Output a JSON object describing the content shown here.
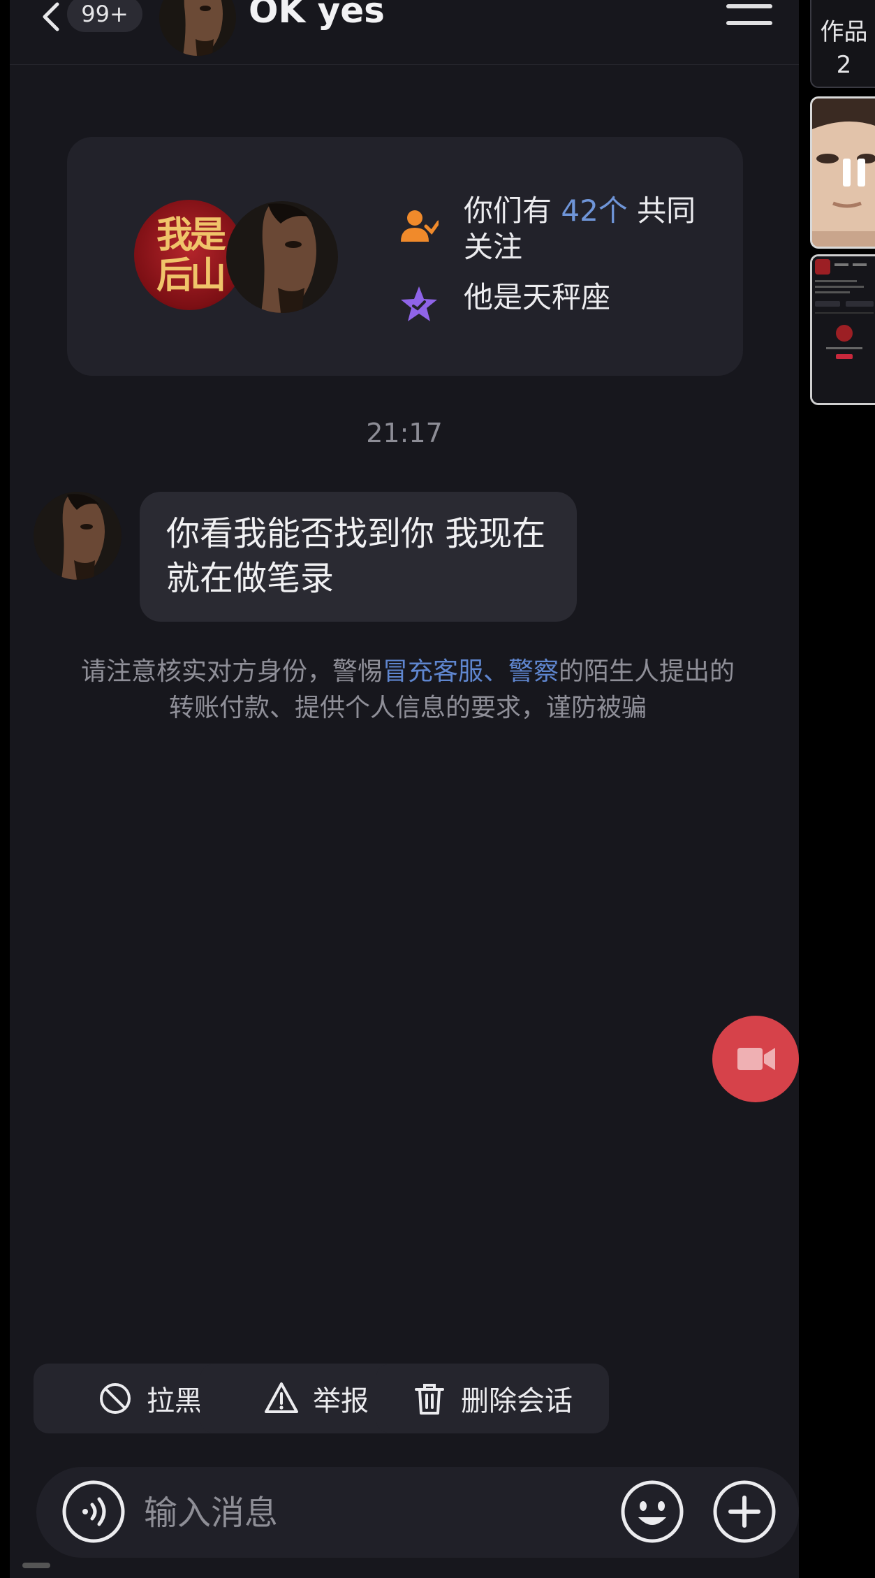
{
  "header": {
    "unread_count": "99+",
    "contact_name": "OK yes"
  },
  "mutual_card": {
    "seal_text": "我是后山",
    "mutual_prefix": "你们有 ",
    "mutual_count": "42个",
    "mutual_suffix": " 共同关注",
    "zodiac": "他是天秤座"
  },
  "timestamp": "21:17",
  "message": {
    "text": "你看我能否找到你 我现在就在做笔录"
  },
  "warning": {
    "part1": "请注意核实对方身份，警惕",
    "link1": "冒充客服",
    "sep": "、",
    "link2": "警察",
    "part2": "的陌生人提出的转账付款、提供个人信息的要求，谨防被骗"
  },
  "actions": {
    "block": "拉黑",
    "report": "举报",
    "delete": "删除会话"
  },
  "input": {
    "placeholder": "输入消息"
  },
  "side_panel": {
    "works_label": "作品",
    "works_count": "2"
  },
  "colors": {
    "background": "#17171d",
    "accent_blue": "#6f95d8",
    "video_button": "#d6424a",
    "mutual_icon": "#f08a2b",
    "star_icon": "#8f64e8"
  },
  "icons": [
    "back-icon",
    "menu-icon",
    "people-icon",
    "star-icon",
    "video-call-icon",
    "block-icon",
    "warning-icon",
    "trash-icon",
    "voice-icon",
    "emoji-icon",
    "plus-icon",
    "pause-icon"
  ]
}
